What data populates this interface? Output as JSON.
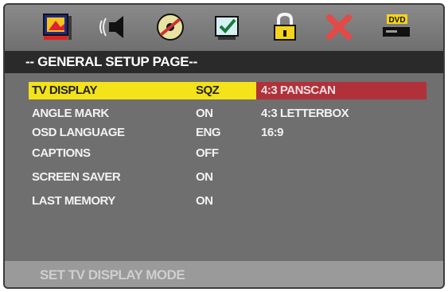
{
  "icons": [
    "general-setup-tv-icon",
    "speaker-sound-icon",
    "disc-video-icon",
    "preference-check-icon",
    "lock-password-icon",
    "exit-x-icon",
    "dvd-player-icon"
  ],
  "title": "-- GENERAL SETUP PAGE--",
  "menu": [
    {
      "label": "TV DISPLAY",
      "value": "SQZ"
    },
    {
      "label": "ANGLE MARK",
      "value": "ON"
    },
    {
      "label": "OSD LANGUAGE",
      "value": "ENG"
    },
    {
      "label": "CAPTIONS",
      "value": "OFF"
    },
    {
      "label": "SCREEN SAVER",
      "value": "ON"
    },
    {
      "label": "LAST MEMORY",
      "value": "ON"
    }
  ],
  "options": [
    "4:3 PANSCAN",
    "4:3 LETTERBOX",
    "16:9"
  ],
  "status": "SET TV DISPLAY MODE",
  "colors": {
    "highlight": "#f4e21a",
    "option_highlight": "#b0313a",
    "panel": "#6f6f6f",
    "title_bar": "#2a2a2a"
  }
}
